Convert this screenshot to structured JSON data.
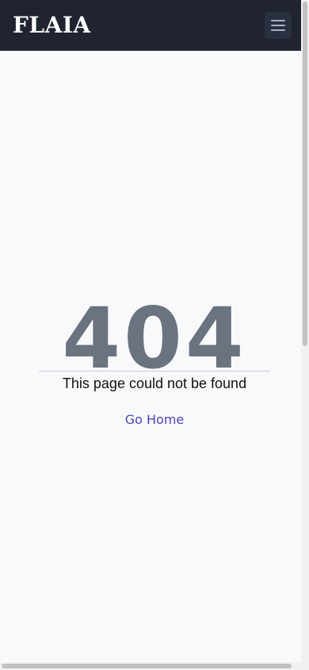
{
  "header": {
    "logo_text": "FLAIA",
    "menu_icon": "hamburger-menu-icon",
    "background": "#1f2430"
  },
  "error": {
    "code": "404",
    "message": "This page could not be found",
    "home_link_label": "Go Home"
  },
  "colors": {
    "page_background": "#f8f9fb",
    "error_code": "#6b7280",
    "link": "#4f46b5"
  }
}
